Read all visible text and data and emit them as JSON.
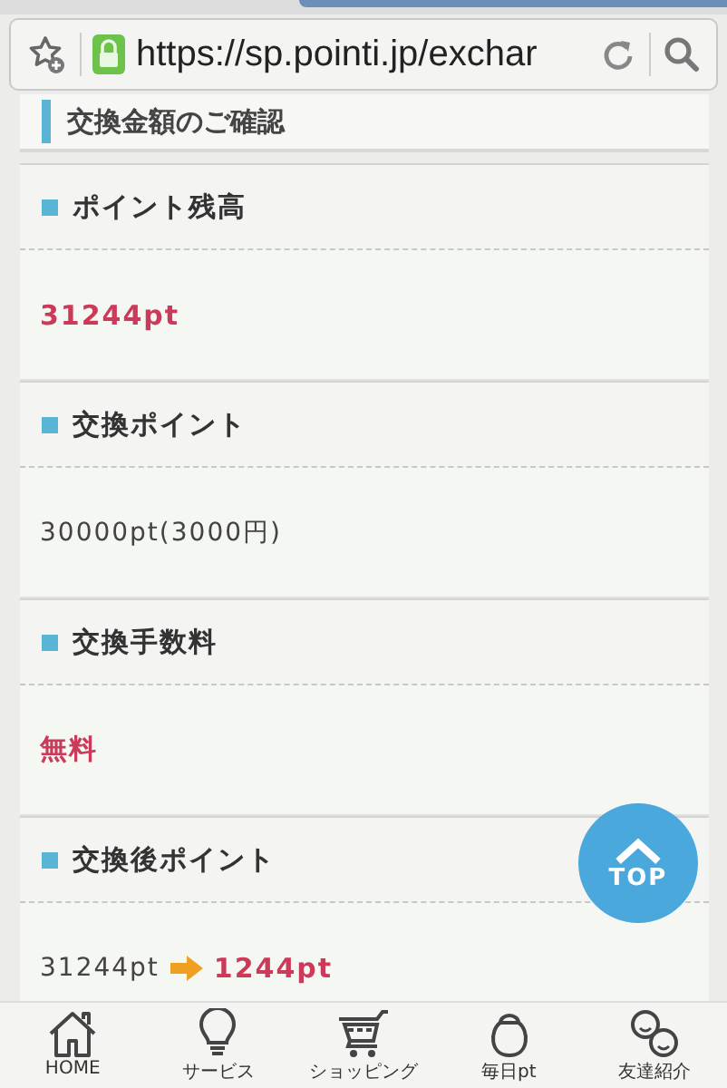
{
  "browser": {
    "url": "https://sp.pointi.jp/exchar"
  },
  "page_title": "交換金額のご確認",
  "sections": [
    {
      "heading": "ポイント残高",
      "value": {
        "kind": "emphasis",
        "text": "31244pt"
      }
    },
    {
      "heading": "交換ポイント",
      "value": {
        "kind": "plain",
        "text": "30000pt(3000円)"
      }
    },
    {
      "heading": "交換手数料",
      "value": {
        "kind": "emphasis",
        "text": "無料"
      }
    },
    {
      "heading": "交換後ポイント",
      "value": {
        "kind": "change",
        "from": "31244pt",
        "to": "1244pt"
      }
    }
  ],
  "top_button": {
    "label": "TOP"
  },
  "nav": [
    {
      "kind": "home",
      "label": "HOME"
    },
    {
      "kind": "bulb",
      "label": "サービス"
    },
    {
      "kind": "cart",
      "label": "ショッピング"
    },
    {
      "kind": "purse",
      "label": "毎日pt"
    },
    {
      "kind": "friends",
      "label": "友達紹介"
    }
  ]
}
